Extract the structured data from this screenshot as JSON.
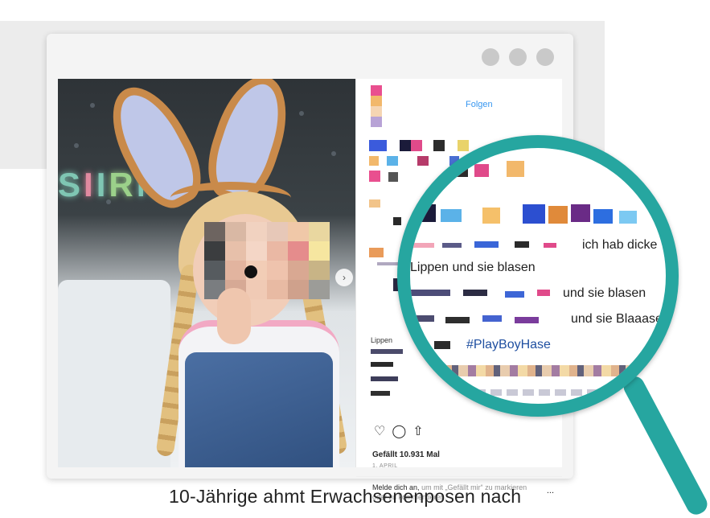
{
  "post": {
    "follow_label": "Folgen",
    "caption_partial_label": "Lippen",
    "likes": "Gefällt 10.931 Mal",
    "date": "1. APRIL",
    "login_link": "Melde dich an,",
    "login_text": "um mit „Gefällt mir“ zu markieren oder zu kommentieren.",
    "more_label": "..."
  },
  "lens": {
    "line1": "ich hab dicke",
    "line2": "Lippen und sie blasen",
    "line3": "und sie blasen",
    "line4": "und sie Blaaasen",
    "hashtag": "#PlayBoyHase"
  },
  "caption": "10-Jährige ahmt Erwachsenenposen nach",
  "icons": [
    "heart-icon",
    "comment-icon",
    "share-icon",
    "next-arrow-icon",
    "window-dots"
  ],
  "colors": {
    "accent": "#26a6a0",
    "link": "#3897f0"
  }
}
